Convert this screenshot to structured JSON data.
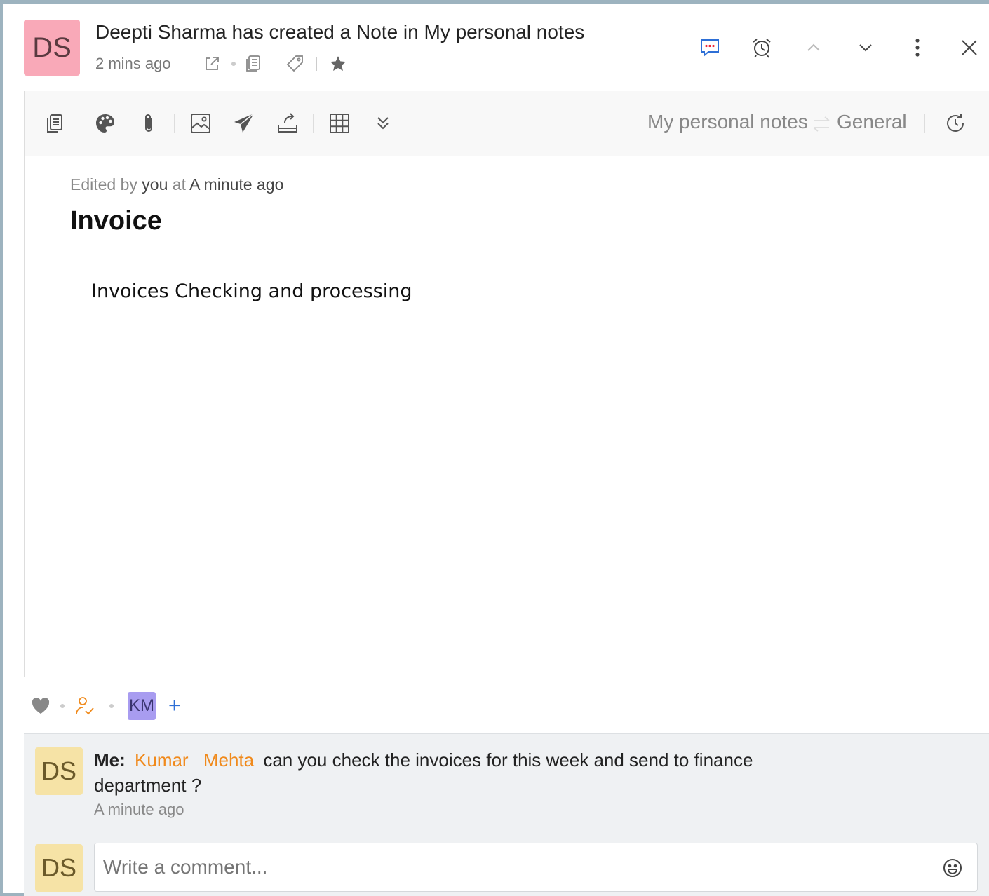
{
  "header": {
    "avatar_initials": "DS",
    "author": "Deepti Sharma",
    "action_text": "has created a Note in",
    "notebook": "My personal notes",
    "time": "2 mins ago"
  },
  "toolbar": {
    "breadcrumb_notebook": "My personal notes",
    "breadcrumb_section": "General"
  },
  "note": {
    "edited_prefix": "Edited by",
    "edited_by": "you",
    "edited_at_label": "at",
    "edited_time": "A minute ago",
    "title": "Invoice",
    "body": "Invoices Checking and processing"
  },
  "reactions": {
    "assignee_initials": "KM",
    "add_label": "+"
  },
  "comment": {
    "avatar_initials": "DS",
    "author_label": "Me:",
    "mention_first": "Kumar",
    "mention_last": "Mehta",
    "text": "can you check the invoices  for this week and send to finance department ?",
    "time": "A minute ago"
  },
  "composer": {
    "avatar_initials": "DS",
    "placeholder": "Write a comment..."
  },
  "colors": {
    "header_avatar": "#f9a9b8",
    "comment_avatar": "#f6e3a6",
    "mention": "#f08a1c",
    "assignee_avatar": "#a89cf0",
    "accent_blue": "#2d6fd6"
  }
}
